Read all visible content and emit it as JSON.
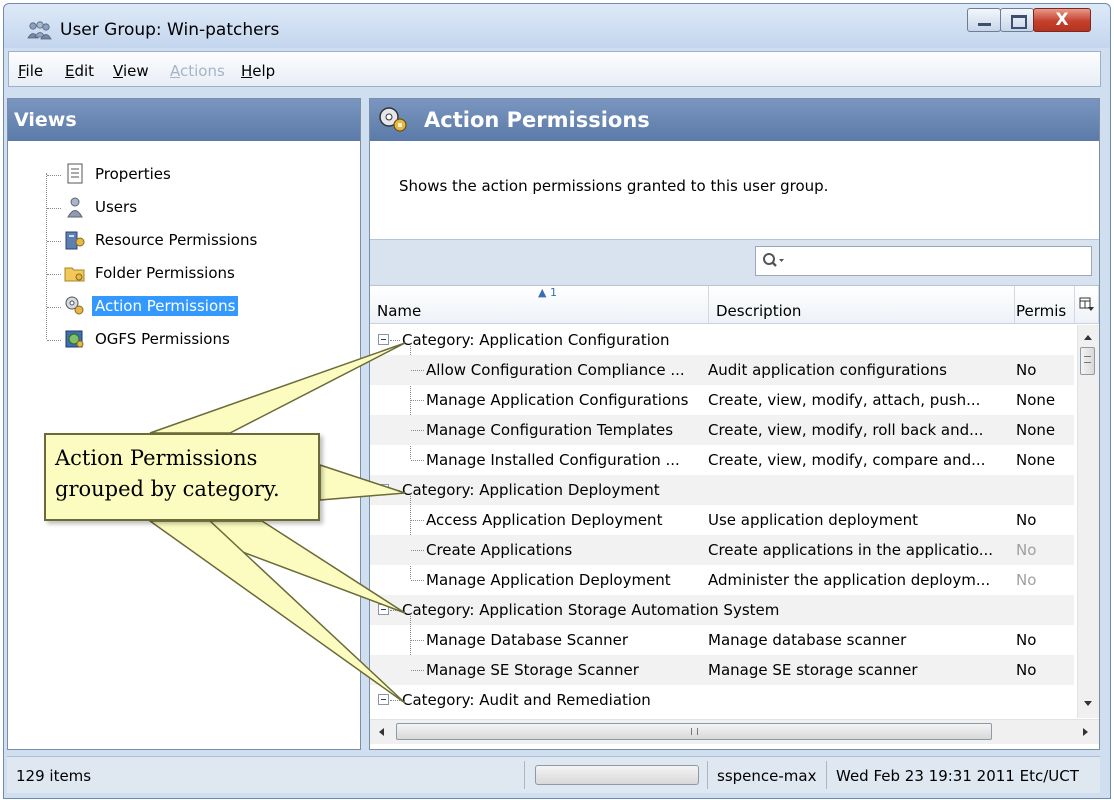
{
  "window": {
    "title": "User Group: Win-patchers",
    "close_label": "X"
  },
  "menu": {
    "file": "File",
    "edit": "Edit",
    "view": "View",
    "actions": "Actions",
    "help": "Help"
  },
  "views": {
    "header": "Views",
    "items": [
      {
        "label": "Properties",
        "icon": "properties-icon"
      },
      {
        "label": "Users",
        "icon": "user-icon"
      },
      {
        "label": "Resource Permissions",
        "icon": "server-key-icon"
      },
      {
        "label": "Folder Permissions",
        "icon": "folder-key-icon"
      },
      {
        "label": "Action Permissions",
        "icon": "action-key-icon",
        "selected": true
      },
      {
        "label": "OGFS Permissions",
        "icon": "globe-key-icon"
      }
    ]
  },
  "action_permissions": {
    "title": "Action Permissions",
    "description": "Shows the action permissions granted to this user group.",
    "search": {
      "value": "",
      "placeholder": ""
    },
    "columns": {
      "name": "Name",
      "description": "Description",
      "permission": "Permis",
      "sort_indicator": "▲ 1"
    },
    "rows": [
      {
        "type": "category",
        "name": "Category: Application Configuration"
      },
      {
        "type": "item",
        "name": "Allow Configuration Compliance ...",
        "description": "Audit application configurations",
        "permission": "No"
      },
      {
        "type": "item",
        "name": "Manage Application Configurations",
        "description": "Create, view, modify, attach, push...",
        "permission": "None"
      },
      {
        "type": "item",
        "name": "Manage Configuration Templates",
        "description": "Create, view, modify, roll back and...",
        "permission": "None"
      },
      {
        "type": "item",
        "name": "Manage Installed Configuration ...",
        "description": "Create, view, modify, compare and...",
        "permission": "None"
      },
      {
        "type": "category",
        "name": "Category: Application Deployment"
      },
      {
        "type": "item",
        "name": "Access Application Deployment",
        "description": "Use application deployment",
        "permission": "No"
      },
      {
        "type": "item",
        "name": "Create Applications",
        "description": "Create applications in the applicatio...",
        "permission": "No",
        "dim": true
      },
      {
        "type": "item",
        "name": "Manage Application Deployment",
        "description": "Administer the application deploym...",
        "permission": "No",
        "dim": true
      },
      {
        "type": "category",
        "name": "Category: Application Storage Automation System"
      },
      {
        "type": "item",
        "name": "Manage Database Scanner",
        "description": "Manage database scanner",
        "permission": "No"
      },
      {
        "type": "item",
        "name": "Manage SE Storage Scanner",
        "description": "Manage SE storage scanner",
        "permission": "No"
      },
      {
        "type": "category",
        "name": "Category: Audit and Remediation"
      }
    ]
  },
  "callout": {
    "line1": "Action Permissions",
    "line2": "grouped by category."
  },
  "status": {
    "items": "129 items",
    "user": "sspence-max",
    "time": "Wed Feb 23 19:31 2011 Etc/UCT"
  },
  "colors": {
    "panel_header": "#6b89b6",
    "selection": "#3399ff",
    "callout_fill": "#fcfcc0"
  }
}
